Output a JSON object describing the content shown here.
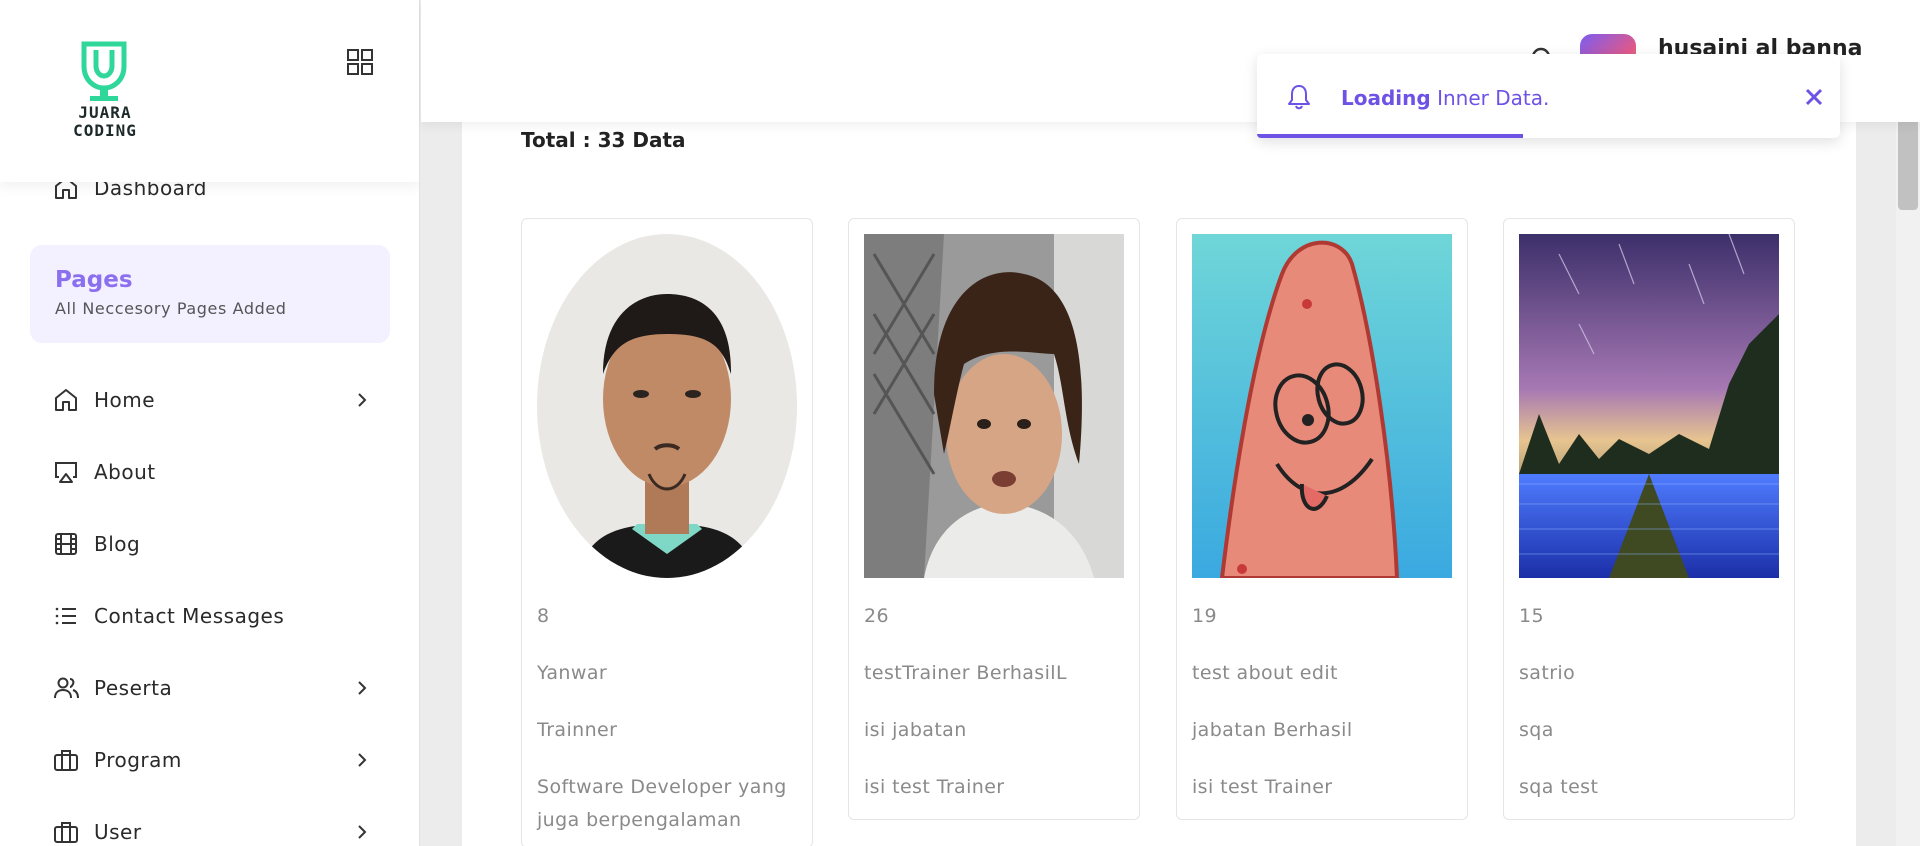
{
  "sidebar": {
    "logo_text_line1": "JUARA",
    "logo_text_line2": "CODING",
    "pages_title": "Pages",
    "pages_subtitle": "All Neccesory Pages Added",
    "items": [
      {
        "label": "Dashboard",
        "icon": "home-icon",
        "has_chevron": false
      },
      {
        "label": "Home",
        "icon": "home-icon",
        "has_chevron": true
      },
      {
        "label": "About",
        "icon": "airplay-icon",
        "has_chevron": false
      },
      {
        "label": "Blog",
        "icon": "film-icon",
        "has_chevron": false
      },
      {
        "label": "Contact Messages",
        "icon": "list-icon",
        "has_chevron": false
      },
      {
        "label": "Peserta",
        "icon": "users-icon",
        "has_chevron": true
      },
      {
        "label": "Program",
        "icon": "briefcase-icon",
        "has_chevron": true
      },
      {
        "label": "User",
        "icon": "briefcase-icon",
        "has_chevron": true
      }
    ]
  },
  "header": {
    "username": "husaini al banna"
  },
  "toast": {
    "bold": "Loading",
    "text": " Inner Data.",
    "progress": 0.46
  },
  "main": {
    "total_label": "Total : 33 Data",
    "cards": [
      {
        "id": "8",
        "name": "Yanwar",
        "position": "Trainner",
        "description": "Software Developer yang juga berpengalaman"
      },
      {
        "id": "26",
        "name": "testTrainer BerhasilL",
        "position": "isi jabatan",
        "description": "isi test Trainer"
      },
      {
        "id": "19",
        "name": "test about edit",
        "position": "jabatan Berhasil",
        "description": "isi test Trainer"
      },
      {
        "id": "15",
        "name": "satrio",
        "position": "sqa",
        "description": "sqa test"
      }
    ]
  },
  "colors": {
    "accent": "#6e52e6",
    "logo_green": "#2fd89a",
    "pages_bg": "#f3f0ff"
  }
}
